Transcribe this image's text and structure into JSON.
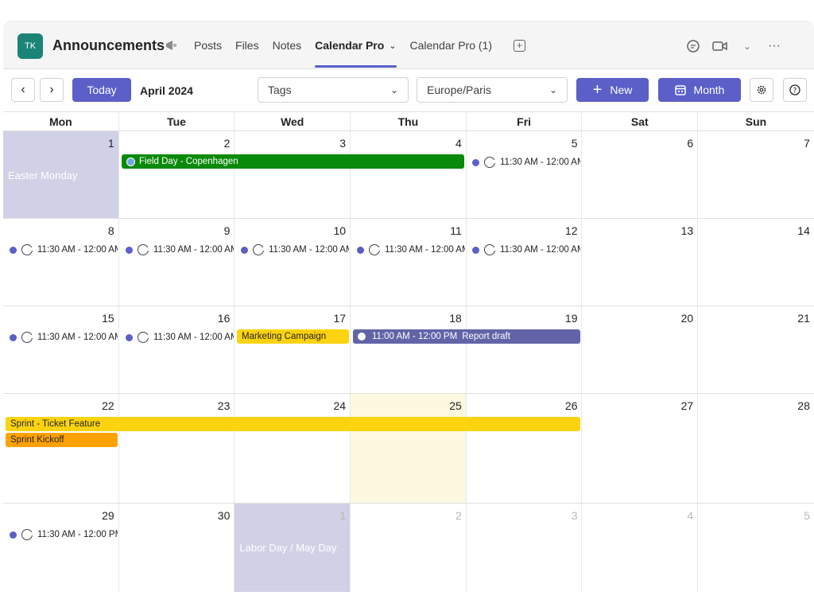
{
  "header": {
    "avatar_initials": "TK",
    "title": "Announcements",
    "tabs": [
      {
        "label": "Posts"
      },
      {
        "label": "Files"
      },
      {
        "label": "Notes"
      },
      {
        "label": "Calendar Pro"
      },
      {
        "label": "Calendar Pro (1)"
      }
    ]
  },
  "toolbar": {
    "today_label": "Today",
    "month_label": "April 2024",
    "tags_label": "Tags",
    "timezone_label": "Europe/Paris",
    "new_label": "New",
    "view_label": "Month"
  },
  "weekdays": [
    "Mon",
    "Tue",
    "Wed",
    "Thu",
    "Fri",
    "Sat",
    "Sun"
  ],
  "weeks": [
    {
      "days": [
        "1",
        "2",
        "3",
        "4",
        "5",
        "6",
        "7"
      ]
    },
    {
      "days": [
        "8",
        "9",
        "10",
        "11",
        "12",
        "13",
        "14"
      ]
    },
    {
      "days": [
        "15",
        "16",
        "17",
        "18",
        "19",
        "20",
        "21"
      ]
    },
    {
      "days": [
        "22",
        "23",
        "24",
        "25",
        "26",
        "27",
        "28"
      ]
    },
    {
      "days": [
        "29",
        "30",
        "1",
        "2",
        "3",
        "4",
        "5"
      ]
    }
  ],
  "holidays": {
    "easter_monday": "Easter Monday",
    "labor_day": "Labor Day / May Day"
  },
  "events": {
    "recurring_time": "11:30 AM - 12:00 AM",
    "recurring_time_pm": "11:30 AM - 12:00 PM",
    "field_day": "Field Day - Copenhagen",
    "marketing": "Marketing Campaign",
    "report_time": "11:00 AM - 12:00 PM",
    "report_title": "Report draft",
    "sprint_feature": "Sprint - Ticket Feature",
    "sprint_kickoff": "Sprint Kickoff"
  },
  "colors": {
    "accent": "#5b5fc7",
    "green_event": "#0a8a0a",
    "yellow_event": "#fdd30f",
    "orange_event": "#ffa200",
    "purple_event": "#6264a7",
    "holiday_bg": "#d0d1e6",
    "today_bg": "#fdf9e1"
  }
}
